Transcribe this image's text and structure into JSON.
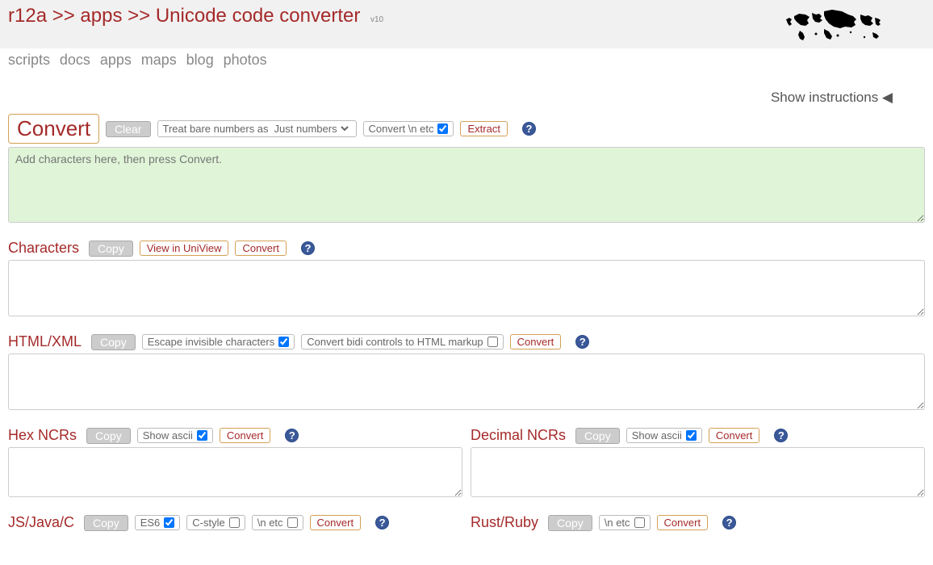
{
  "header": {
    "crumb1": "r12a",
    "crumb2": "apps",
    "crumb3": "Unicode code converter",
    "sep": ">>",
    "version": "v10"
  },
  "nav": {
    "scripts": "scripts",
    "docs": "docs",
    "apps": "apps",
    "maps": "maps",
    "blog": "blog",
    "photos": "photos"
  },
  "instructions": "Show instructions ◀",
  "mainInput": {
    "convert": "Convert",
    "clear": "Clear",
    "treatLabel": "Treat bare numbers as",
    "treatSelected": "Just numbers",
    "convertN": "Convert \\n etc",
    "extract": "Extract",
    "placeholder": "Add characters here, then press Convert."
  },
  "characters": {
    "title": "Characters",
    "copy": "Copy",
    "viewUniView": "View in UniView",
    "convert": "Convert"
  },
  "htmlxml": {
    "title": "HTML/XML",
    "copy": "Copy",
    "escapeInvisible": "Escape invisible characters",
    "bidiMarkup": "Convert bidi controls to HTML markup",
    "convert": "Convert"
  },
  "hexNcrs": {
    "title": "Hex NCRs",
    "copy": "Copy",
    "showAscii": "Show ascii",
    "convert": "Convert"
  },
  "decNcrs": {
    "title": "Decimal NCRs",
    "copy": "Copy",
    "showAscii": "Show ascii",
    "convert": "Convert"
  },
  "jsjavac": {
    "title": "JS/Java/C",
    "copy": "Copy",
    "es6": "ES6",
    "cstyle": "C-style",
    "netc": "\\n etc",
    "convert": "Convert"
  },
  "rustruby": {
    "title": "Rust/Ruby",
    "copy": "Copy",
    "netc": "\\n etc",
    "convert": "Convert"
  }
}
